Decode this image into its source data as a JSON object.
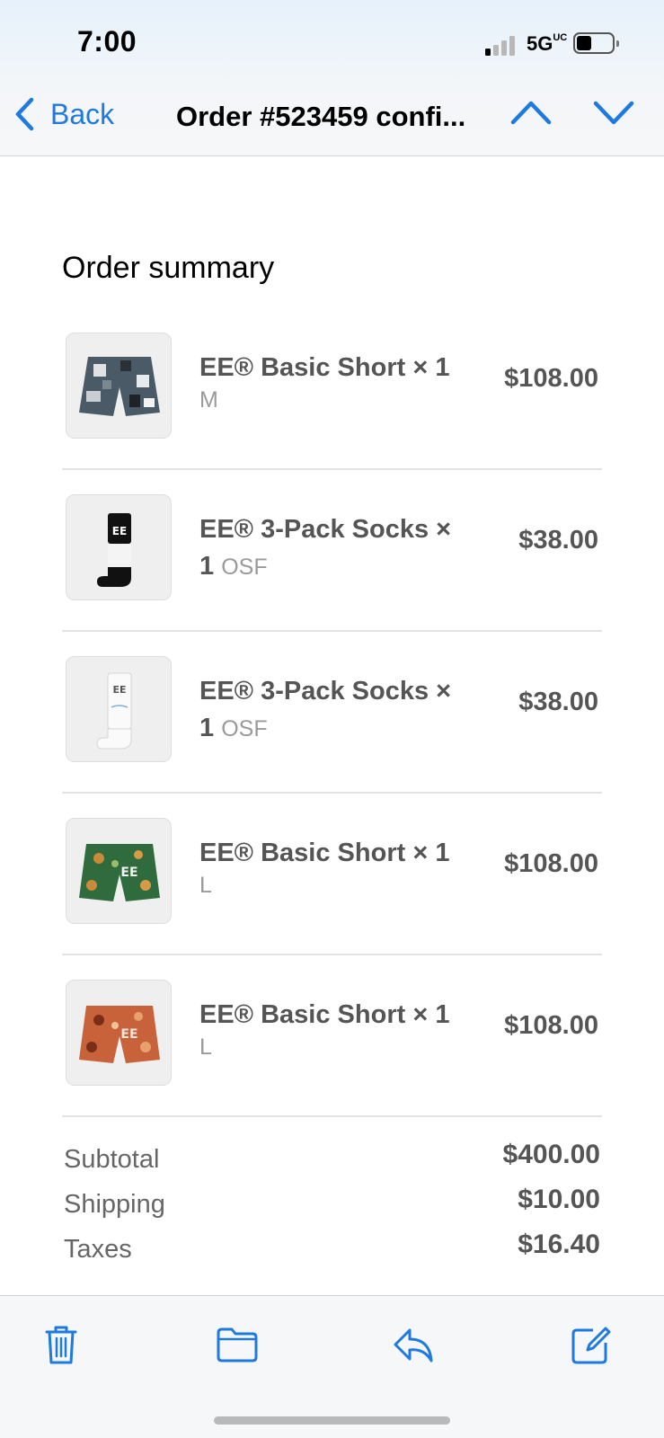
{
  "status_bar": {
    "time": "7:00",
    "network": "5G",
    "network_suffix": "UC"
  },
  "nav": {
    "back_label": "Back",
    "title": "Order #523459 confi...",
    "icons": {
      "back": "chevron-left-icon",
      "prev": "chevron-up-icon",
      "next": "chevron-down-icon"
    }
  },
  "summary": {
    "title": "Order summary",
    "items": [
      {
        "name": "EE® Basic Short × 1",
        "variant": "M",
        "price": "$108.00",
        "image": "camo-shorts"
      },
      {
        "name": "EE® 3-Pack Socks × 1",
        "variant": "OSF",
        "price": "$38.00",
        "image": "black-socks"
      },
      {
        "name": "EE® 3-Pack Socks × 1",
        "variant": "OSF",
        "price": "$38.00",
        "image": "white-socks"
      },
      {
        "name": "EE® Basic Short × 1",
        "variant": "L",
        "price": "$108.00",
        "image": "green-floral-shorts"
      },
      {
        "name": "EE® Basic Short × 1",
        "variant": "L",
        "price": "$108.00",
        "image": "orange-floral-shorts"
      }
    ],
    "totals": [
      {
        "label": "Subtotal",
        "value": "$400.00"
      },
      {
        "label": "Shipping",
        "value": "$10.00"
      },
      {
        "label": "Taxes",
        "value": "$16.40"
      }
    ]
  },
  "toolbar": {
    "icons": [
      "trash-icon",
      "folder-icon",
      "reply-icon",
      "compose-icon"
    ]
  },
  "colors": {
    "accent": "#1f7ae0",
    "text_muted": "#9a9a9a",
    "divider": "#e3e3e3"
  }
}
